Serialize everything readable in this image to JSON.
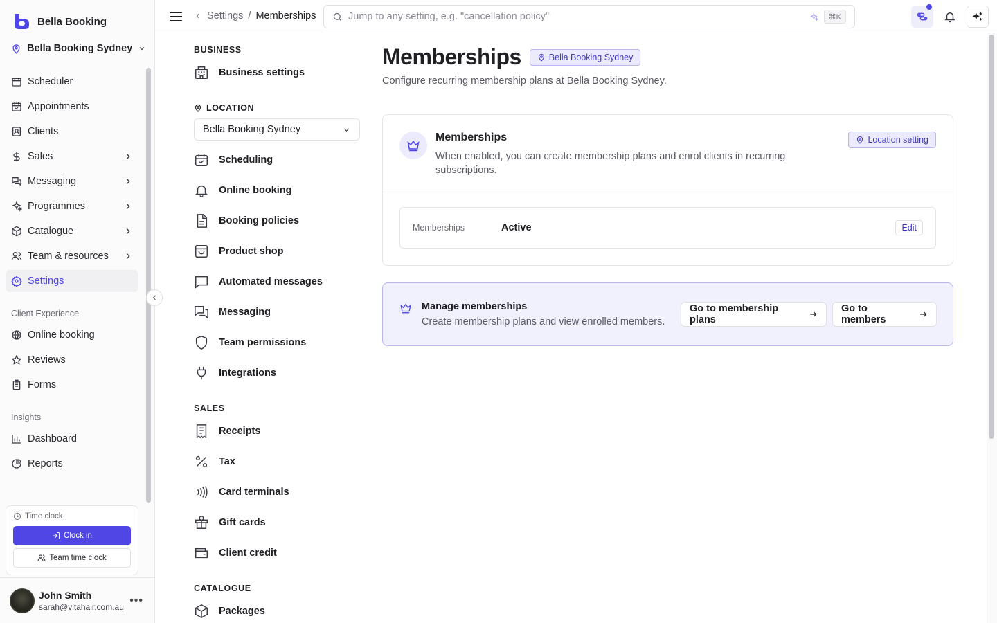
{
  "brand": {
    "name": "Bella Booking"
  },
  "location_selector": {
    "value": "Bella Booking Sydney"
  },
  "sidebar": {
    "items": [
      {
        "label": "Scheduler"
      },
      {
        "label": "Appointments"
      },
      {
        "label": "Clients"
      },
      {
        "label": "Sales"
      },
      {
        "label": "Messaging"
      },
      {
        "label": "Programmes"
      },
      {
        "label": "Catalogue"
      },
      {
        "label": "Team & resources"
      },
      {
        "label": "Settings"
      }
    ],
    "client_experience": {
      "heading": "Client Experience",
      "items": [
        {
          "label": "Online booking"
        },
        {
          "label": "Reviews"
        },
        {
          "label": "Forms"
        }
      ]
    },
    "insights": {
      "heading": "Insights",
      "items": [
        {
          "label": "Dashboard"
        },
        {
          "label": "Reports"
        }
      ]
    },
    "time_clock": {
      "title": "Time clock",
      "clock_in": "Clock in",
      "team": "Team time clock"
    },
    "user": {
      "name": "John Smith",
      "email": "sarah@vitahair.com.au"
    }
  },
  "topbar": {
    "breadcrumb": {
      "parent": "Settings",
      "separator": "/",
      "current": "Memberships"
    },
    "search": {
      "placeholder": "Jump to any setting, e.g. \"cancellation policy\"",
      "shortcut": "⌘K"
    }
  },
  "subnav": {
    "business": {
      "heading": "BUSINESS",
      "items": [
        {
          "label": "Business settings"
        }
      ]
    },
    "location": {
      "heading": "LOCATION",
      "select_value": "Bella Booking Sydney",
      "items": [
        {
          "label": "Scheduling"
        },
        {
          "label": "Online booking"
        },
        {
          "label": "Booking policies"
        },
        {
          "label": "Product shop"
        },
        {
          "label": "Automated messages"
        },
        {
          "label": "Messaging"
        },
        {
          "label": "Team permissions"
        },
        {
          "label": "Integrations"
        }
      ]
    },
    "sales": {
      "heading": "SALES",
      "items": [
        {
          "label": "Receipts"
        },
        {
          "label": "Tax"
        },
        {
          "label": "Card terminals"
        },
        {
          "label": "Gift cards"
        },
        {
          "label": "Client credit"
        }
      ]
    },
    "catalogue": {
      "heading": "CATALOGUE",
      "items": [
        {
          "label": "Packages"
        }
      ]
    }
  },
  "main": {
    "title": "Memberships",
    "location_chip": "Bella Booking Sydney",
    "subtitle": "Configure recurring membership plans at Bella Booking Sydney.",
    "card": {
      "title": "Memberships",
      "description": "When enabled, you can create membership plans and enrol clients in recurring subscriptions.",
      "scope_chip": "Location setting",
      "row": {
        "label": "Memberships",
        "value": "Active",
        "edit": "Edit"
      }
    },
    "manage": {
      "title": "Manage memberships",
      "description": "Create membership plans and view enrolled members.",
      "plans_button": "Go to membership plans",
      "members_button": "Go to members"
    }
  },
  "colors": {
    "accent": "#4f46e5",
    "chip_bg": "#eceafd",
    "chip_border": "#b9b6ee"
  }
}
